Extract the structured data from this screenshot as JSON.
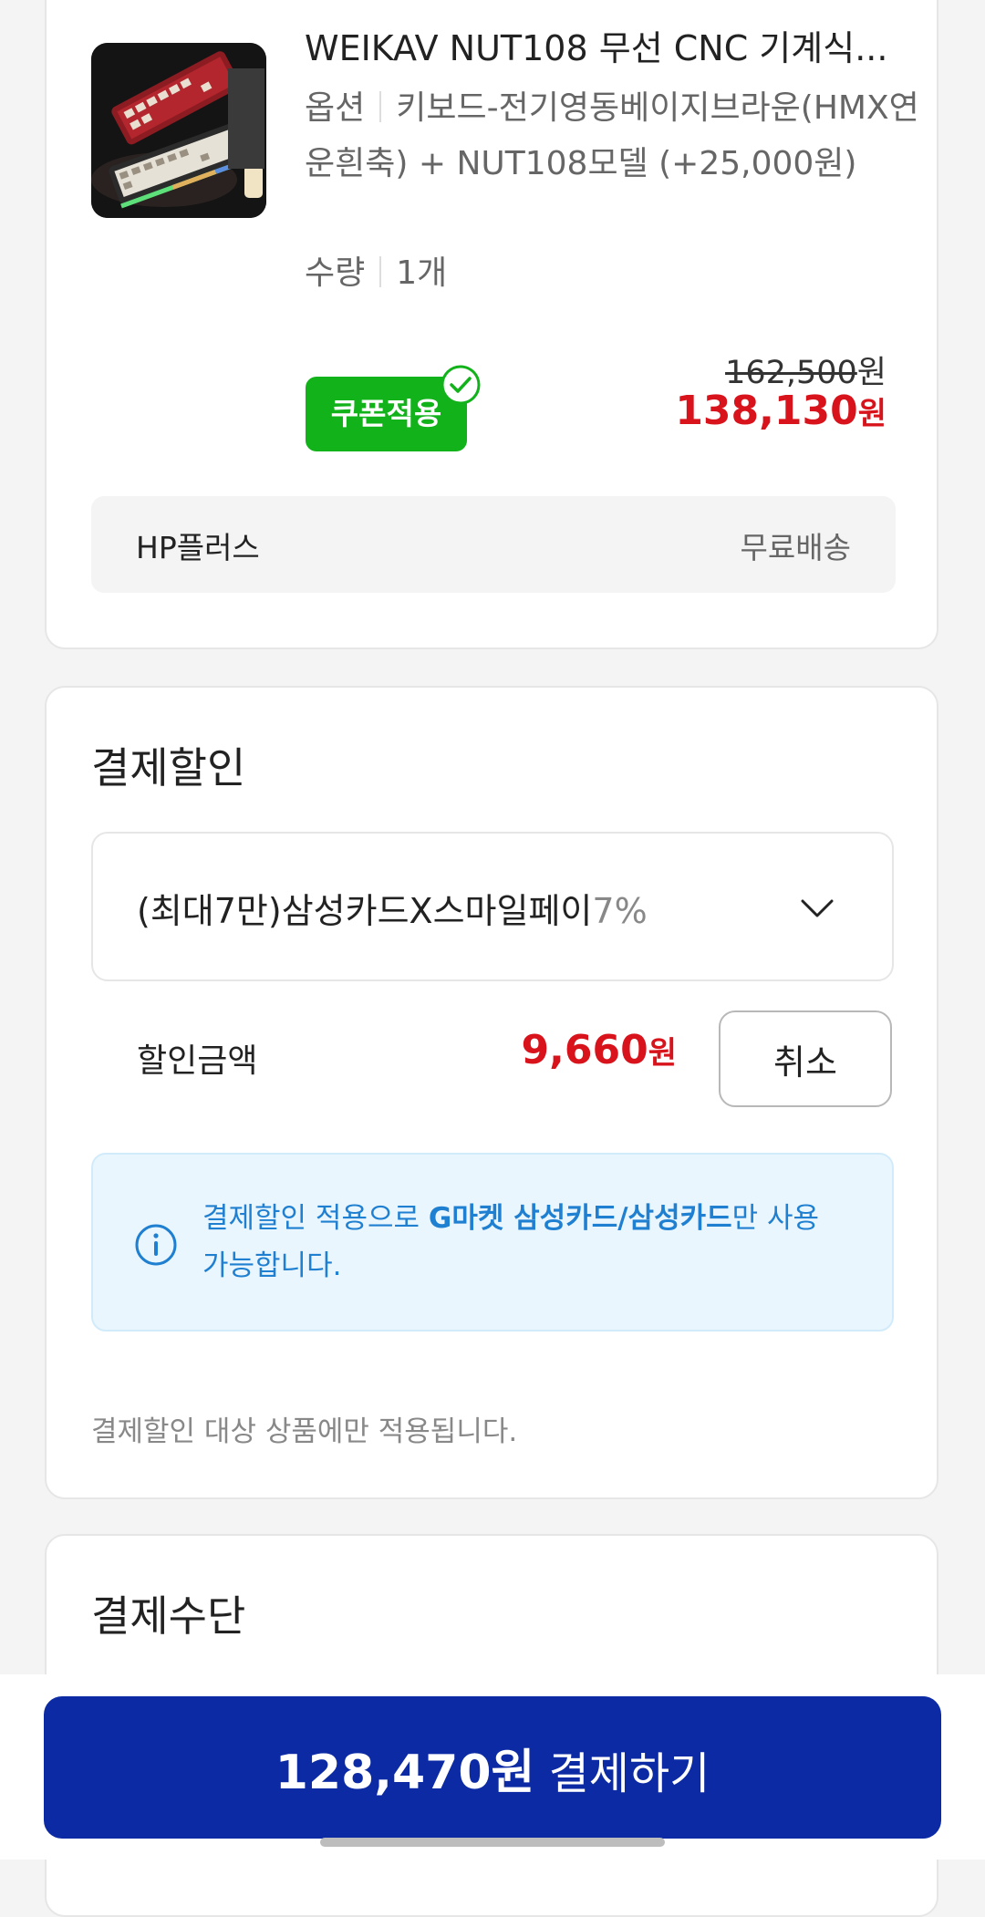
{
  "product": {
    "title": "WEIKAV NUT108 무선 CNC 기계식...",
    "option_label": "옵션",
    "option_value": "키보드-전기영동베이지브라운(HMX연운흰축) + NUT108모델 (+25,000원)",
    "qty_label": "수량",
    "qty_value": "1개",
    "coupon_badge": "쿠폰적용",
    "price_original": "162,500",
    "price_sale": "138,130",
    "won": "원",
    "shipping_label": "HP플러스",
    "shipping_value": "무료배송"
  },
  "discount": {
    "title": "결제할인",
    "selected_card": "(최대7만)삼성카드X스마일페이",
    "selected_pct": "7%",
    "amount_label": "할인금액",
    "amount": "9,660",
    "won": "원",
    "cancel_label": "취소",
    "info_pre": "결제할인 적용으로 ",
    "info_bold": "G마켓 삼성카드/삼성카드",
    "info_post": "만 사용 가능합니다.",
    "note": "결제할인 대상 상품에만 적용됩니다."
  },
  "payment_method": {
    "title": "결제수단"
  },
  "pay_button": {
    "amount": "128,470원",
    "label": " 결제하기"
  },
  "colors": {
    "sale_red": "#d8131b",
    "coupon_green": "#12b21b",
    "pay_blue": "#0b2aa3",
    "info_blue": "#1f7fd0"
  }
}
